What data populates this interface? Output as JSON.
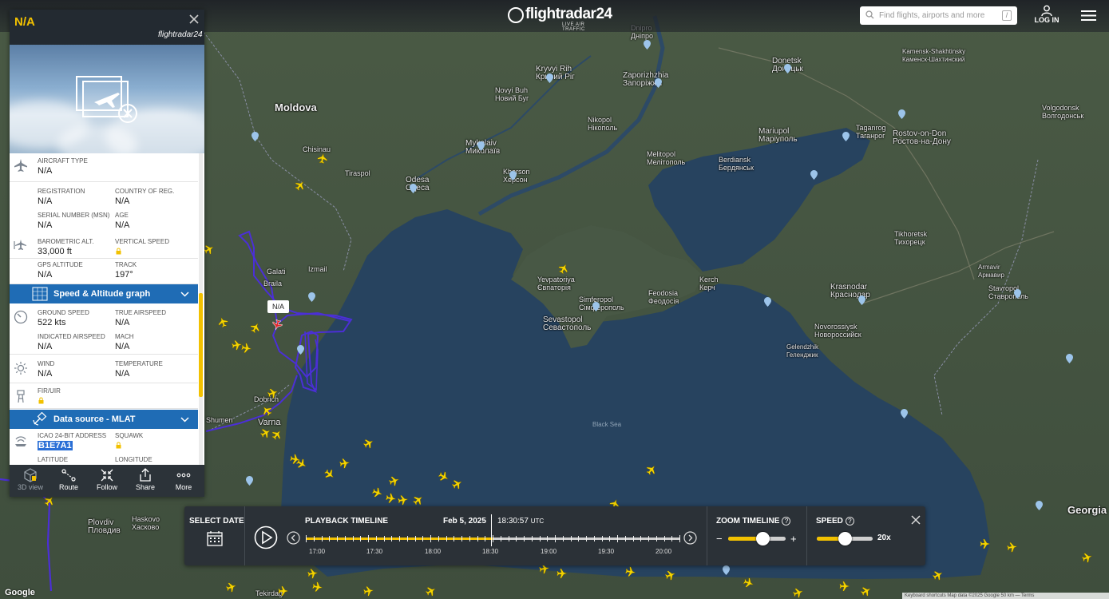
{
  "app": {
    "brand": "flightradar24",
    "tagline": "LIVE AIR TRAFFIC",
    "search_placeholder": "Find flights, airports and more",
    "search_shortcut": "/",
    "login_label": "LOG IN"
  },
  "colors": {
    "accent": "#f2c100",
    "band": "#1f6cb5",
    "panel_head": "#232a31",
    "track": "#4b2fd6",
    "plane": "#f5d400"
  },
  "panel": {
    "title": "N/A",
    "brand": "flightradar24",
    "aircraft_type_label": "AIRCRAFT TYPE",
    "aircraft_type": "N/A",
    "registration_label": "REGISTRATION",
    "registration": "N/A",
    "country_label": "COUNTRY OF REG.",
    "country": "N/A",
    "serial_label": "SERIAL NUMBER (MSN)",
    "serial": "N/A",
    "age_label": "AGE",
    "age": "N/A",
    "baro_alt_label": "BAROMETRIC ALT.",
    "baro_alt": "33,000 ft",
    "vspeed_label": "VERTICAL SPEED",
    "gps_alt_label": "GPS ALTITUDE",
    "gps_alt": "N/A",
    "track_label": "TRACK",
    "track": "197°",
    "speed_band": "Speed & Altitude graph",
    "ground_speed_label": "GROUND SPEED",
    "ground_speed": "522 kts",
    "true_airspeed_label": "TRUE AIRSPEED",
    "true_airspeed": "N/A",
    "ias_label": "INDICATED AIRSPEED",
    "ias": "N/A",
    "mach_label": "MACH",
    "mach": "N/A",
    "wind_label": "WIND",
    "wind": "N/A",
    "temp_label": "TEMPERATURE",
    "temp": "N/A",
    "fir_label": "FIR/UIR",
    "source_band": "Data source - MLAT",
    "icao_label": "ICAO 24-BIT ADDRESS",
    "icao": "B1E7A1",
    "squawk_label": "SQUAWK",
    "latitude_label": "LATITUDE",
    "longitude_label": "LONGITUDE"
  },
  "footer_buttons": [
    {
      "label": "3D view"
    },
    {
      "label": "Route"
    },
    {
      "label": "Follow"
    },
    {
      "label": "Share"
    },
    {
      "label": "More"
    }
  ],
  "timeline": {
    "select_date": "SELECT DATE",
    "playback_label": "PLAYBACK TIMELINE",
    "date": "Feb 5, 2025",
    "time": "18:30:57",
    "tz": "UTC",
    "ticks": [
      "17:00",
      "17:30",
      "18:00",
      "18:30",
      "19:00",
      "19:30",
      "20:00"
    ],
    "zoom_label": "ZOOM TIMELINE",
    "zoom_level": 0.6,
    "speed_label": "SPEED",
    "speed_value": "20x",
    "speed_level": 0.5
  },
  "map": {
    "marker_label": "N/A",
    "footnote": "Keyboard shortcuts   Map data ©2025 Google   50 km ⎯⎯   Terms",
    "google": "Google",
    "cities": [
      {
        "name": "Moldova",
        "big": true
      },
      {
        "name": "Chisinau"
      },
      {
        "name": "Tiraspol"
      },
      {
        "name": "Odesa\nОдеса"
      },
      {
        "name": "Mykolaiv\nМиколаїв"
      },
      {
        "name": "Kherson\nХерсон"
      },
      {
        "name": "Kryvyi Rih\nКривий Ріг"
      },
      {
        "name": "Zaporizhzhia\nЗапоріжжя"
      },
      {
        "name": "Donetsk\nДонецьк"
      },
      {
        "name": "Mariupol\nМаріуполь"
      },
      {
        "name": "Melitopol\nМелітополь"
      },
      {
        "name": "Berdiansk\nБердянськ"
      },
      {
        "name": "Taganrog\nТаганрог"
      },
      {
        "name": "Rostov-on-Don\nРостов-на-Дону"
      },
      {
        "name": "Yevpatoriya\nЄвпаторія"
      },
      {
        "name": "Simferopol\nСімферополь"
      },
      {
        "name": "Sevastopol\nСевастополь"
      },
      {
        "name": "Feodosia\nФеодосія"
      },
      {
        "name": "Kerch\nКерч"
      },
      {
        "name": "Krasnodar\nКраснодар"
      },
      {
        "name": "Novorossiysk\nНовороссийск"
      },
      {
        "name": "Stavropol\nСтаврополь"
      },
      {
        "name": "Galati"
      },
      {
        "name": "Braila"
      },
      {
        "name": "Izmail"
      },
      {
        "name": "Varna"
      },
      {
        "name": "Dobrich"
      },
      {
        "name": "Shumen"
      },
      {
        "name": "Plovdiv\nПловдив"
      },
      {
        "name": "Haskovo\nХасково"
      },
      {
        "name": "Tekirdağ"
      },
      {
        "name": "Georgia",
        "big": true
      },
      {
        "name": "Black Sea",
        "sea": true
      },
      {
        "name": "Volgodonsk\nВолгодонськ"
      },
      {
        "name": "Nikopol\nНікополь"
      },
      {
        "name": "Novyi Buh\nНовий Буг"
      },
      {
        "name": "Dnipro\nДніпро"
      },
      {
        "name": "Kamensk-Shakhtinsky\nКаменск-Шахтинский"
      },
      {
        "name": "Tikhoretsk\nТихорецк"
      },
      {
        "name": "Armavir\nАрмавир"
      },
      {
        "name": "Gelendzhik\nГеленджик"
      }
    ]
  }
}
